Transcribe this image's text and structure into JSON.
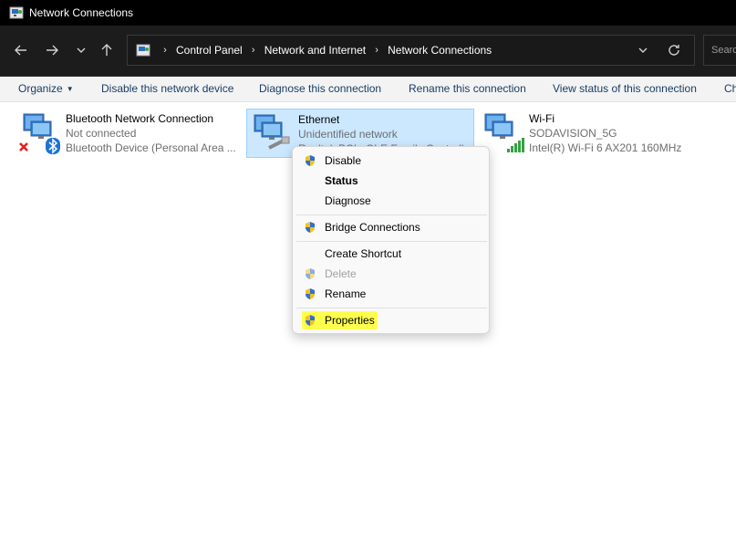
{
  "window": {
    "title": "Network Connections",
    "icon": "network-folder-icon"
  },
  "nav": {
    "back": "back-arrow-icon",
    "forward": "forward-arrow-icon",
    "recent": "chevron-down-icon",
    "up": "up-arrow-icon"
  },
  "address": {
    "breadcrumbs": [
      "Control Panel",
      "Network and Internet",
      "Network Connections"
    ],
    "icons": {
      "separator": "›"
    }
  },
  "search": {
    "placeholder": "Search Network Connections",
    "visible_text": "Searc"
  },
  "commands": {
    "organize": "Organize",
    "disable": "Disable this network device",
    "diagnose": "Diagnose this connection",
    "rename": "Rename this connection",
    "view_status": "View status of this connection",
    "change": "Ch"
  },
  "connections": [
    {
      "name": "Bluetooth Network Connection",
      "status": "Not connected",
      "device": "Bluetooth Device (Personal Area ..."
    },
    {
      "name": "Ethernet",
      "status": "Unidentified network",
      "device": "Realtek PCIe GbE Family Controller"
    },
    {
      "name": "Wi-Fi",
      "status": "SODAVISION_5G",
      "device": "Intel(R) Wi-Fi 6 AX201 160MHz"
    }
  ],
  "context_menu": {
    "disable": "Disable",
    "status": "Status",
    "diagnose": "Diagnose",
    "bridge": "Bridge Connections",
    "shortcut": "Create Shortcut",
    "delete": "Delete",
    "rename": "Rename",
    "properties": "Properties"
  },
  "colors": {
    "highlight": "#ffff4d",
    "selection_bg": "#cce8ff",
    "selection_border": "#99d1ff",
    "link_text": "#1a3d66"
  }
}
